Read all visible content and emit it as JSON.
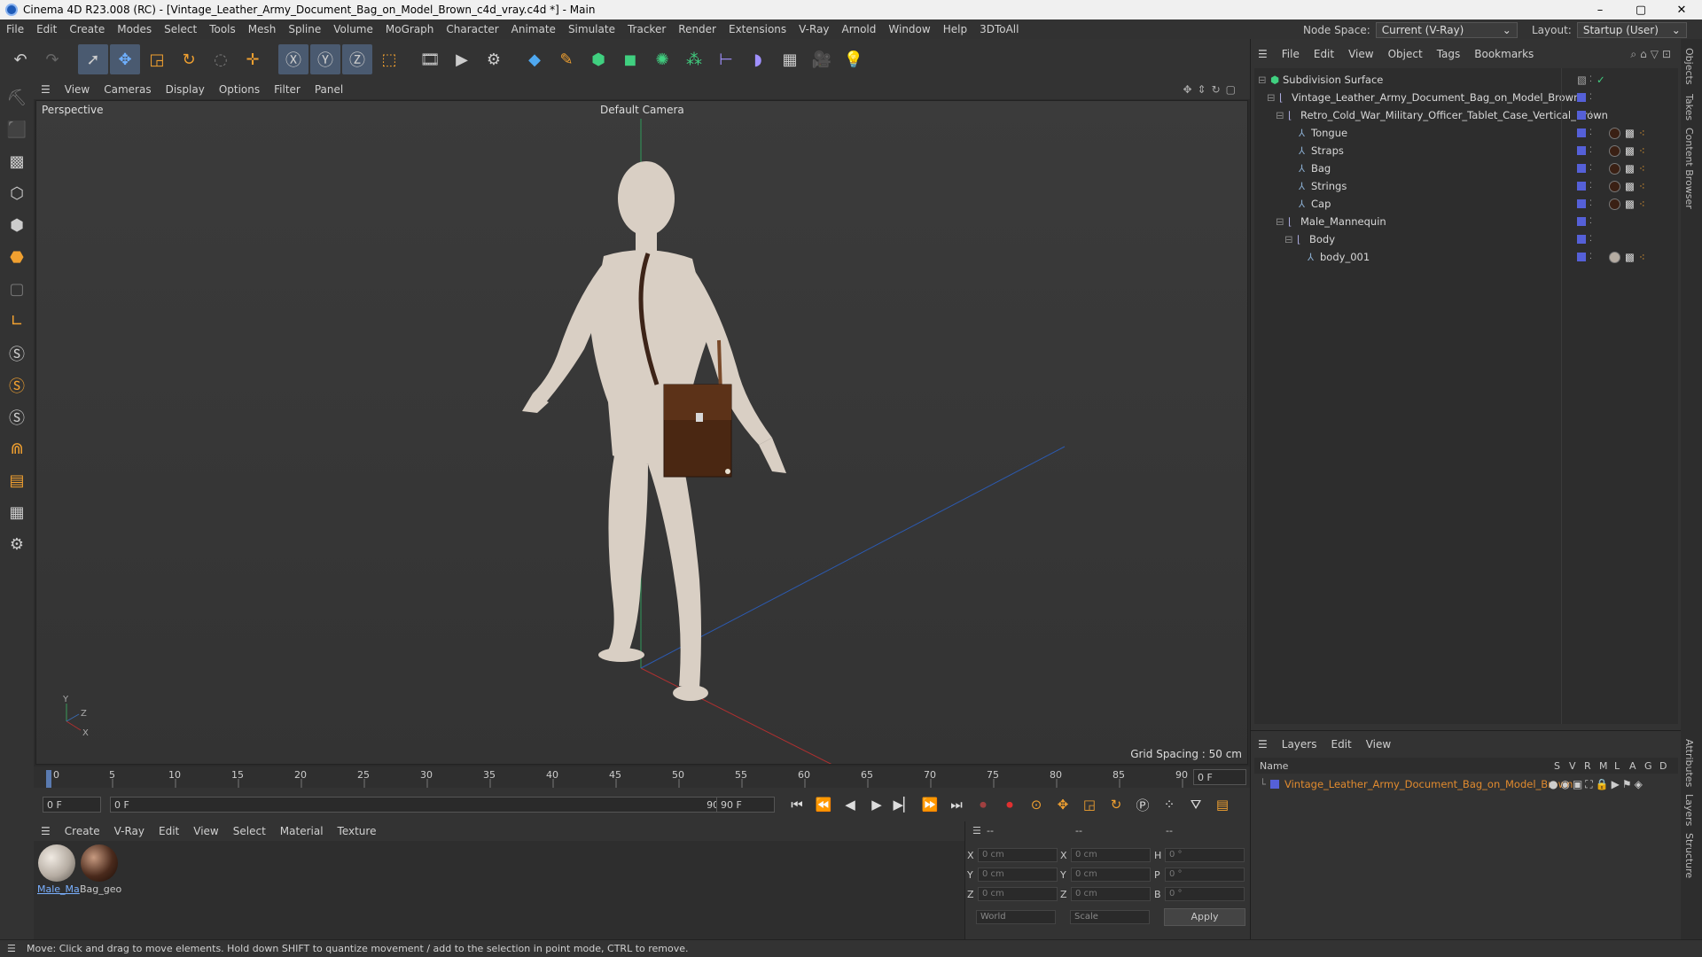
{
  "window": {
    "title": "Cinema 4D R23.008 (RC) - [Vintage_Leather_Army_Document_Bag_on_Model_Brown_c4d_vray.c4d *] - Main",
    "controls": [
      "–",
      "▢",
      "✕"
    ]
  },
  "menubar": {
    "items": [
      "File",
      "Edit",
      "Create",
      "Modes",
      "Select",
      "Tools",
      "Mesh",
      "Spline",
      "Volume",
      "MoGraph",
      "Character",
      "Animate",
      "Simulate",
      "Tracker",
      "Render",
      "Extensions",
      "V-Ray",
      "Arnold",
      "Window",
      "Help",
      "3DToAll"
    ],
    "node_space_label": "Node Space:",
    "node_space_value": "Current (V-Ray)",
    "layout_label": "Layout:",
    "layout_value": "Startup (User)"
  },
  "viewport": {
    "menu": [
      "View",
      "Cameras",
      "Display",
      "Options",
      "Filter",
      "Panel"
    ],
    "label": "Perspective",
    "camera": "Default Camera",
    "grid_spacing": "Grid Spacing : 50 cm",
    "axis_labels": [
      "Y",
      "Z",
      "X"
    ]
  },
  "timeline": {
    "ticks": [
      "0",
      "5",
      "10",
      "15",
      "20",
      "25",
      "30",
      "35",
      "40",
      "45",
      "50",
      "55",
      "60",
      "65",
      "70",
      "75",
      "80",
      "85",
      "90"
    ],
    "current_frame": "0 F",
    "start_field": "0 F",
    "range_start": "0 F",
    "range_end": "90 F",
    "end_field": "90 F"
  },
  "materials": {
    "menu": [
      "Create",
      "V-Ray",
      "Edit",
      "View",
      "Select",
      "Material",
      "Texture"
    ],
    "items": [
      {
        "name": "Male_Ma",
        "color": "#b5aca2"
      },
      {
        "name": "Bag_geo",
        "color": "#4a2a1c"
      }
    ]
  },
  "coords": {
    "header": [
      "--",
      "--",
      "--"
    ],
    "rows": [
      {
        "a": "X",
        "av": "0 cm",
        "b": "X",
        "bv": "0 cm",
        "c": "H",
        "cv": "0 °"
      },
      {
        "a": "Y",
        "av": "0 cm",
        "b": "Y",
        "bv": "0 cm",
        "c": "P",
        "cv": "0 °"
      },
      {
        "a": "Z",
        "av": "0 cm",
        "b": "Z",
        "bv": "0 cm",
        "c": "B",
        "cv": "0 °"
      }
    ],
    "mode1": "World",
    "mode2": "Scale",
    "apply": "Apply"
  },
  "objects": {
    "menu": [
      "File",
      "Edit",
      "View",
      "Object",
      "Tags",
      "Bookmarks"
    ],
    "tree": [
      {
        "name": "Subdivision Surface",
        "depth": 0,
        "icon": "subdiv"
      },
      {
        "name": "Vintage_Leather_Army_Document_Bag_on_Model_Brown",
        "depth": 1,
        "icon": "null"
      },
      {
        "name": "Retro_Cold_War_Military_Officer_Tablet_Case_Vertical_Brown",
        "depth": 2,
        "icon": "null"
      },
      {
        "name": "Tongue",
        "depth": 3,
        "icon": "poly"
      },
      {
        "name": "Straps",
        "depth": 3,
        "icon": "poly"
      },
      {
        "name": "Bag",
        "depth": 3,
        "icon": "poly"
      },
      {
        "name": "Strings",
        "depth": 3,
        "icon": "poly"
      },
      {
        "name": "Cap",
        "depth": 3,
        "icon": "poly"
      },
      {
        "name": "Male_Mannequin",
        "depth": 2,
        "icon": "null"
      },
      {
        "name": "Body",
        "depth": 3,
        "icon": "null"
      },
      {
        "name": "body_001",
        "depth": 4,
        "icon": "poly"
      }
    ]
  },
  "layers": {
    "menu": [
      "Layers",
      "Edit",
      "View"
    ],
    "header_name": "Name",
    "header_cols": [
      "S",
      "V",
      "R",
      "M",
      "L",
      "A",
      "G",
      "D"
    ],
    "row": "Vintage_Leather_Army_Document_Bag_on_Model_Brown",
    "row_color": "#e08a2e"
  },
  "right_tabs": [
    "Objects",
    "Takes",
    "Content Browser",
    "Attributes",
    "Layers",
    "Structure"
  ],
  "status": "Move: Click and drag to move elements. Hold down SHIFT to quantize movement / add to the selection in point mode, CTRL to remove.",
  "colors": {
    "accent": "#4a5a70",
    "tag": "#5560d8",
    "layer_text": "#e08a2e"
  }
}
